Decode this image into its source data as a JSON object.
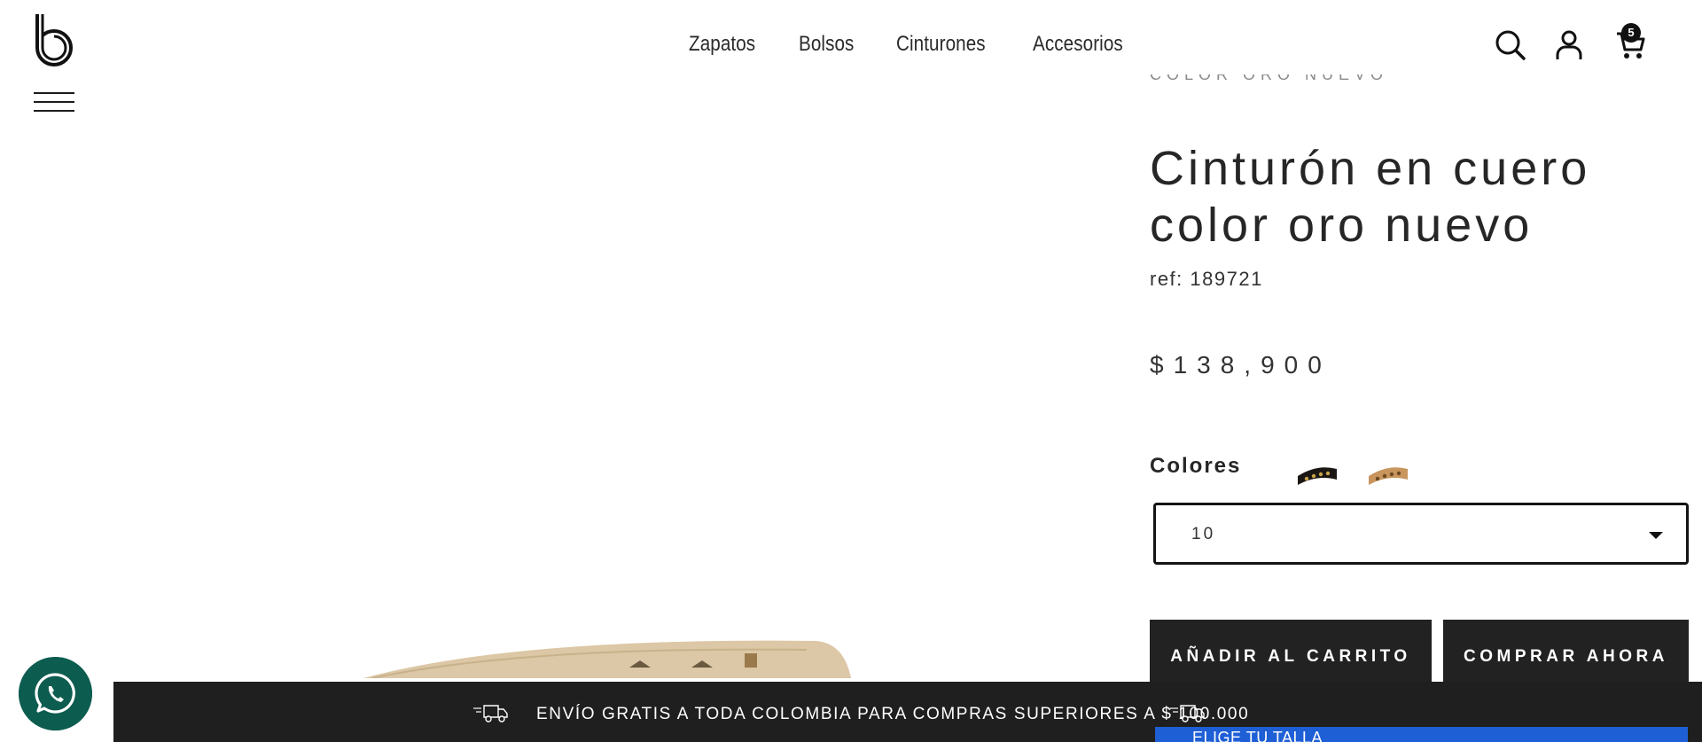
{
  "header": {
    "nav": [
      "Zapatos",
      "Bolsos",
      "Cinturones",
      "Accesorios"
    ],
    "cart_count": "5",
    "icons": [
      "search-icon",
      "user-icon",
      "cart-icon",
      "hamburger-icon"
    ]
  },
  "product": {
    "overline": "COLOR ORO NUEVO",
    "title": "Cinturón en cuero color oro nuevo",
    "ref": "ref: 189721",
    "price": "$138,900",
    "colors_label": "Colores",
    "size_select_value": "10",
    "add_to_cart": "AÑADIR AL CARRITO",
    "buy_now": "COMPRAR AHORA",
    "dropdown_option": "ELIGE TU TALLA"
  },
  "shipping_bar": {
    "text": "ENVÍO GRATIS A TODA COLOMBIA PARA COMPRAS SUPERIORES A $ 100.000"
  },
  "colors": {
    "accent_blue": "#1e5fd6",
    "button_dark": "#222222",
    "whatsapp_green": "#0c5c4f"
  }
}
